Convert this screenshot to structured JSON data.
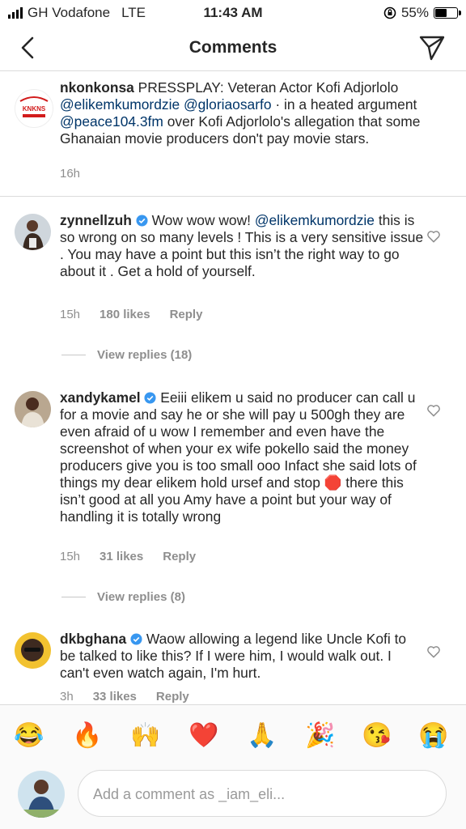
{
  "status_bar": {
    "carrier": "GH Vodafone",
    "network": "LTE",
    "time": "11:43 AM",
    "battery": "55%",
    "battery_level": 0.55
  },
  "header": {
    "title": "Comments",
    "back_icon": "chevron-left-icon",
    "send_icon": "paper-plane-icon"
  },
  "caption": {
    "username": "nkonkonsa",
    "text_start": "PRESSPLAY: Veteran Actor Kofi Adjorlolo",
    "mention1": "@elikemkumordzie",
    "mention2": "@gloriaosarfo",
    "text_mid": "· in a heated argument",
    "mention3": "@peace104.3fm",
    "text_end": "over  Kofi Adjorlolo's allegation that some Ghanaian movie producers don't pay movie stars.",
    "time": "16h",
    "avatar_logo": "KNKNS"
  },
  "comments": [
    {
      "username": "zynnellzuh",
      "verified": true,
      "text_start": "Wow wow wow!",
      "mention": "@elikemkumordzie",
      "text_end": "this is so wrong on so many levels ! This is a very sensitive issue . You may have a point but this isn’t the right way to go about it . Get a hold of yourself.",
      "time": "15h",
      "likes": "180 likes",
      "reply": "Reply",
      "view_replies": "View replies (18)"
    },
    {
      "username": "xandykamel",
      "verified": true,
      "text_start": "Eeiii elikem u said no producer can call u for a movie and say he or she will pay u 500gh they are even afraid of u wow I remember and even have the screenshot of when your ex wife pokello said the money producers give you is too small ooo Infact she said lots of things my dear elikem hold ursef and stop",
      "emoji": "🛑",
      "text_end": "there this isn’t good at all you Amy have a point but your way of handling it is totally wrong",
      "time": "15h",
      "likes": "31 likes",
      "reply": "Reply",
      "view_replies": "View replies (8)"
    },
    {
      "username": "dkbghana",
      "verified": true,
      "text": "Waow allowing a legend like Uncle Kofi to be talked to like this? If I were him, I would walk out. I can't even watch again, I'm hurt.",
      "time": "3h",
      "likes": "33 likes",
      "reply": "Reply"
    }
  ],
  "emoji_bar": [
    "😂",
    "🔥",
    "🙌",
    "❤️",
    "🙏",
    "🎉",
    "😘",
    "😭"
  ],
  "composer": {
    "placeholder": "Add a comment as _iam_eli..."
  },
  "colors": {
    "mention": "#003569",
    "verified": "#3897f0",
    "meta": "#8e8e8e",
    "divider": "#dbdbdb"
  }
}
